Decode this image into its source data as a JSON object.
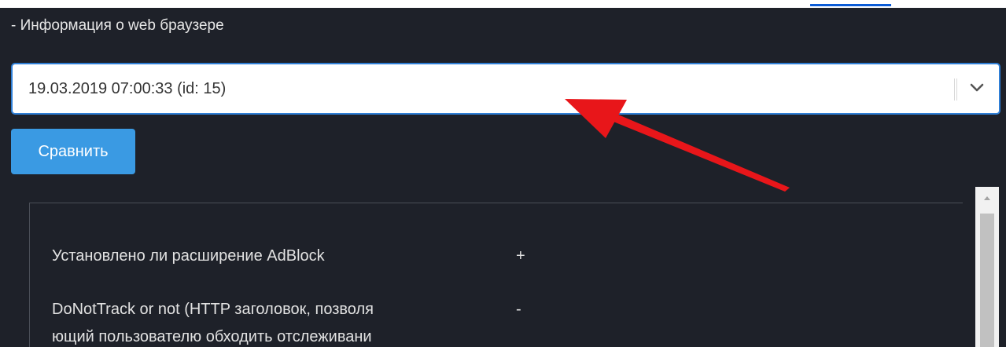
{
  "section": {
    "title": "- Информация о web браузере"
  },
  "select": {
    "value": "19.03.2019 07:00:33 (id: 15)"
  },
  "compare_button": {
    "label": "Сравнить"
  },
  "rows": [
    {
      "label": "Установлено ли расширение AdBlock",
      "value": "+"
    },
    {
      "label": "DoNotTrack or not (HTTP заголовок, позволя",
      "value": "-"
    },
    {
      "label": "ющий пользователю обходить отслеживани",
      "value": ""
    }
  ],
  "colors": {
    "panel_bg": "#1e2129",
    "accent": "#3a9ae3",
    "select_border": "#2f7fd6",
    "annotation_arrow": "#e8161a"
  },
  "icons": {
    "dropdown": "chevron-down-icon",
    "annotation": "red-arrow-annotation"
  }
}
